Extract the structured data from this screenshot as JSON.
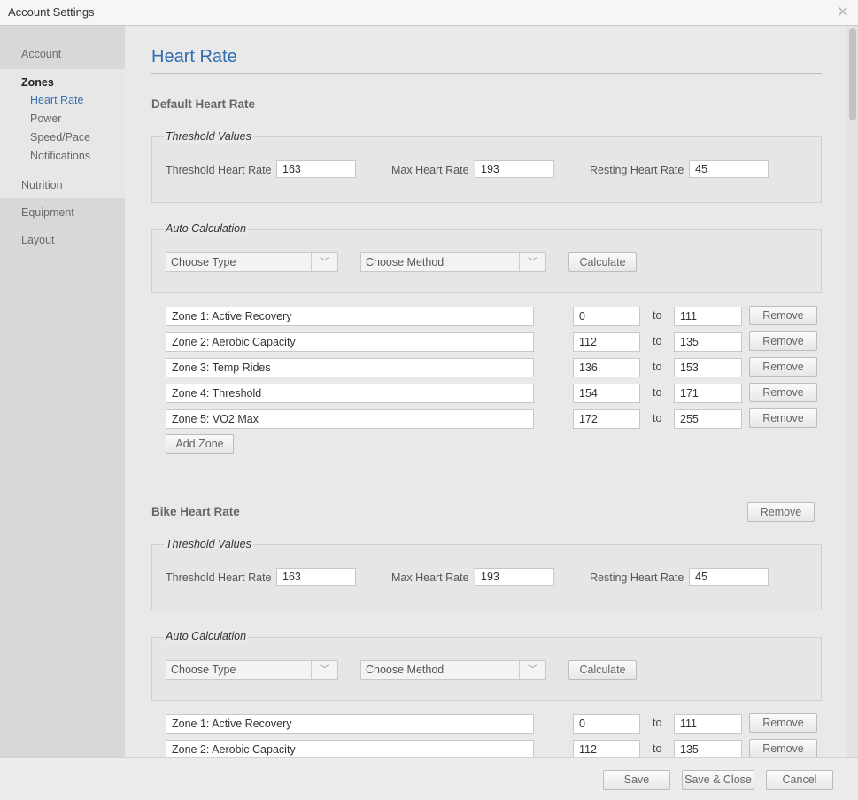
{
  "window": {
    "title": "Account Settings",
    "close_icon": "close-icon"
  },
  "sidebar": {
    "account": "Account",
    "zones": "Zones",
    "zone_items": [
      "Heart Rate",
      "Power",
      "Speed/Pace",
      "Notifications"
    ],
    "nutrition": "Nutrition",
    "equipment": "Equipment",
    "layout": "Layout"
  },
  "main": {
    "title": "Heart Rate",
    "default": {
      "heading": "Default Heart Rate",
      "threshold_legend": "Threshold Values",
      "threshold_label": "Threshold Heart Rate",
      "threshold_value": "163",
      "max_label": "Max Heart Rate",
      "max_value": "193",
      "resting_label": "Resting Heart Rate",
      "resting_value": "45",
      "auto_legend": "Auto Calculation",
      "type_select": "Choose Type",
      "method_select": "Choose Method",
      "calculate": "Calculate",
      "zones": [
        {
          "name": "Zone 1: Active Recovery",
          "from": "0",
          "to": "111"
        },
        {
          "name": "Zone 2: Aerobic Capacity",
          "from": "112",
          "to": "135"
        },
        {
          "name": "Zone 3: Temp Rides",
          "from": "136",
          "to": "153"
        },
        {
          "name": "Zone 4: Threshold",
          "from": "154",
          "to": "171"
        },
        {
          "name": "Zone 5: VO2 Max",
          "from": "172",
          "to": "255"
        }
      ],
      "to_label": "to",
      "remove": "Remove",
      "add_zone": "Add Zone"
    },
    "bike": {
      "heading": "Bike Heart Rate",
      "remove": "Remove",
      "threshold_legend": "Threshold Values",
      "threshold_label": "Threshold Heart Rate",
      "threshold_value": "163",
      "max_label": "Max Heart Rate",
      "max_value": "193",
      "resting_label": "Resting Heart Rate",
      "resting_value": "45",
      "auto_legend": "Auto Calculation",
      "type_select": "Choose Type",
      "method_select": "Choose Method",
      "calculate": "Calculate",
      "zones": [
        {
          "name": "Zone 1: Active Recovery",
          "from": "0",
          "to": "111"
        },
        {
          "name": "Zone 2: Aerobic Capacity",
          "from": "112",
          "to": "135"
        }
      ],
      "to_label": "to",
      "zone_remove": "Remove"
    }
  },
  "footer": {
    "save": "Save",
    "save_close": "Save & Close",
    "cancel": "Cancel"
  }
}
